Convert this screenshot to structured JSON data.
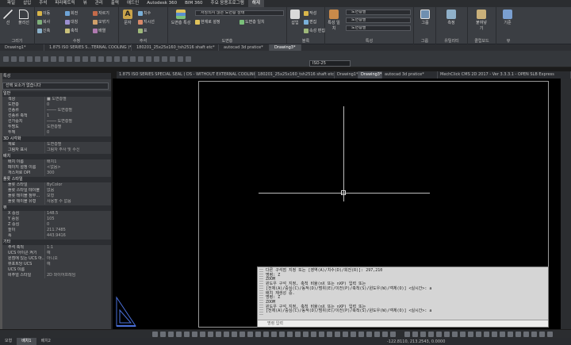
{
  "menu": [
    "파일",
    "삽입",
    "주석",
    "파라메트릭",
    "뷰",
    "관리",
    "출력",
    "애드인",
    "Autodesk 360",
    "BIM 360",
    "주요 응용프로그램",
    "해제"
  ],
  "menu_active_index": 11,
  "ribbon": {
    "draw": {
      "label": "그리기",
      "line": "선",
      "polyline": "폴리선",
      "circle": "원",
      "arc": "호"
    },
    "modify": {
      "label": "수정",
      "items": [
        "이동",
        "회전",
        "자르기",
        "복사",
        "대칭",
        "모깎기",
        "신축",
        "축척",
        "배열"
      ]
    },
    "annotation": {
      "label": "주석",
      "text": "문자",
      "dim": "치수",
      "leader": "지시선",
      "table": "표"
    },
    "layers": {
      "label": "도면층",
      "layer_props": "도면층 특성",
      "unsaved_state": "저장되지 않은 도면층 상태",
      "layer_cur": "현재로 설정",
      "match": "도면층 일치"
    },
    "block": {
      "label": "블록",
      "insert": "삽입",
      "create": "작성",
      "edit": "편집",
      "attr_edit": "속성 편집"
    },
    "properties": {
      "label": "특성",
      "match_props": "특성 일치",
      "color": "도면층별",
      "linetype": "도면층별",
      "lineweight": "도면층별"
    },
    "groups": {
      "label": "그룹",
      "group": "그룹"
    },
    "utilities": {
      "label": "유틸리티",
      "measure": "측정"
    },
    "clipboard": {
      "label": "클립보드",
      "paste": "붙여넣기"
    },
    "view": {
      "label": "뷰",
      "base": "기준"
    }
  },
  "tabs_top": [
    "Drawing1*",
    "1.875 ISO SERIES S...TERNAL COOLING )*",
    "180201_25x25x160_tsh2516 shaft etc*",
    "autocad 3d pratice*",
    "Drawing3*"
  ],
  "tabs_top_active": 4,
  "dim_style": "ISO-25",
  "doc_tabs": [
    "1.875 ISO SERIES SPECIAL SEAL ( DS - WITHOUT EXTERNAL COOLING )*",
    "180201_25x25x160_tsh2516 shaft etc*",
    "Drawing1*",
    "Drawing3*",
    "autocad 3d pratice*",
    "MechClick CMS 2D 2017 - Ver 3.3.3.1 - OPEN SLB Express"
  ],
  "doc_tabs_active": 3,
  "props": {
    "title": "특성",
    "selection": "선택 요소가 없습니다",
    "sections": [
      {
        "name": "일반",
        "rows": [
          [
            "색상",
            "■ 도면층별"
          ],
          [
            "도면층",
            "0"
          ],
          [
            "선종류",
            "──── 도면층별"
          ],
          [
            "선종류 축척",
            "1"
          ],
          [
            "선가중치",
            "──── 도면층별"
          ],
          [
            "투명도",
            "도면층별"
          ],
          [
            "두께",
            "0"
          ]
        ]
      },
      {
        "name": "3D 시각화",
        "rows": [
          [
            "재료",
            "도면층별"
          ],
          [
            "그림자 표시",
            "그림자 주사 및 수신"
          ]
        ]
      },
      {
        "name": "플롯 스타일",
        "rows": [
          [
            "플롯 스타일",
            "ByColor"
          ],
          [
            "플롯 스타일 테이블",
            "없음"
          ],
          [
            "플롯 테이블 첨부...",
            "모형"
          ],
          [
            "플롯 테이블 유형",
            "사용할 수 없음"
          ]
        ]
      },
      {
        "name": "뷰",
        "rows": [
          [
            "X 중심",
            "148.5"
          ],
          [
            "Y 중심",
            "105"
          ],
          [
            "Z 중심",
            "0"
          ],
          [
            "높이",
            "211.7485"
          ],
          [
            "폭",
            "443.9416"
          ]
        ]
      },
      {
        "name": "기타",
        "rows": [
          [
            "주석 축척",
            "1:1"
          ],
          [
            "UCS 아이콘 켜기",
            "예"
          ],
          [
            "원점에 있는 UCS 아...",
            "아니오"
          ],
          [
            "뷰포트당 UCS",
            "예"
          ],
          [
            "UCS 이름",
            ""
          ],
          [
            "비주얼 스타일",
            "2D 와이어프레임"
          ]
        ]
      }
    ],
    "paper_section": {
      "name": "배치",
      "rows": [
        [
          "배치 이름",
          "배치1"
        ],
        [
          "페이지 설정 이름",
          "<없음>"
        ],
        [
          "개스처로 DPI",
          "300"
        ]
      ]
    }
  },
  "command": {
    "history": "다른 구석점 지정 또는 [영역(A)/치수(D)/회전(R)]: 297,210\n명령: Z\nZOOM\n윈도우 구석 지정, 축척 비율(nX 또는 nXP) 입력 또는\n[전체(A)/중심(C)/동적(D)/범위(E)/이전(P)/축척(S)/윈도우(W)/객체(O)] <실시간>: a\n배치 재생성 중.\n명령: Z\nZOOM\n윈도우 구석 지정, 축척 비율(nX 또는 nXP) 입력 또는\n[전체(A)/중심(C)/동적(D)/범위(E)/이전(P)/축척(S)/윈도우(W)/객체(O)] <실시간>: a",
    "input_placeholder": "명령 입력"
  },
  "layout_tabs": [
    "모형",
    "배치1",
    "배치2"
  ],
  "layout_active": 1,
  "coords": "-122.8110, 213.2543, 0.0000"
}
